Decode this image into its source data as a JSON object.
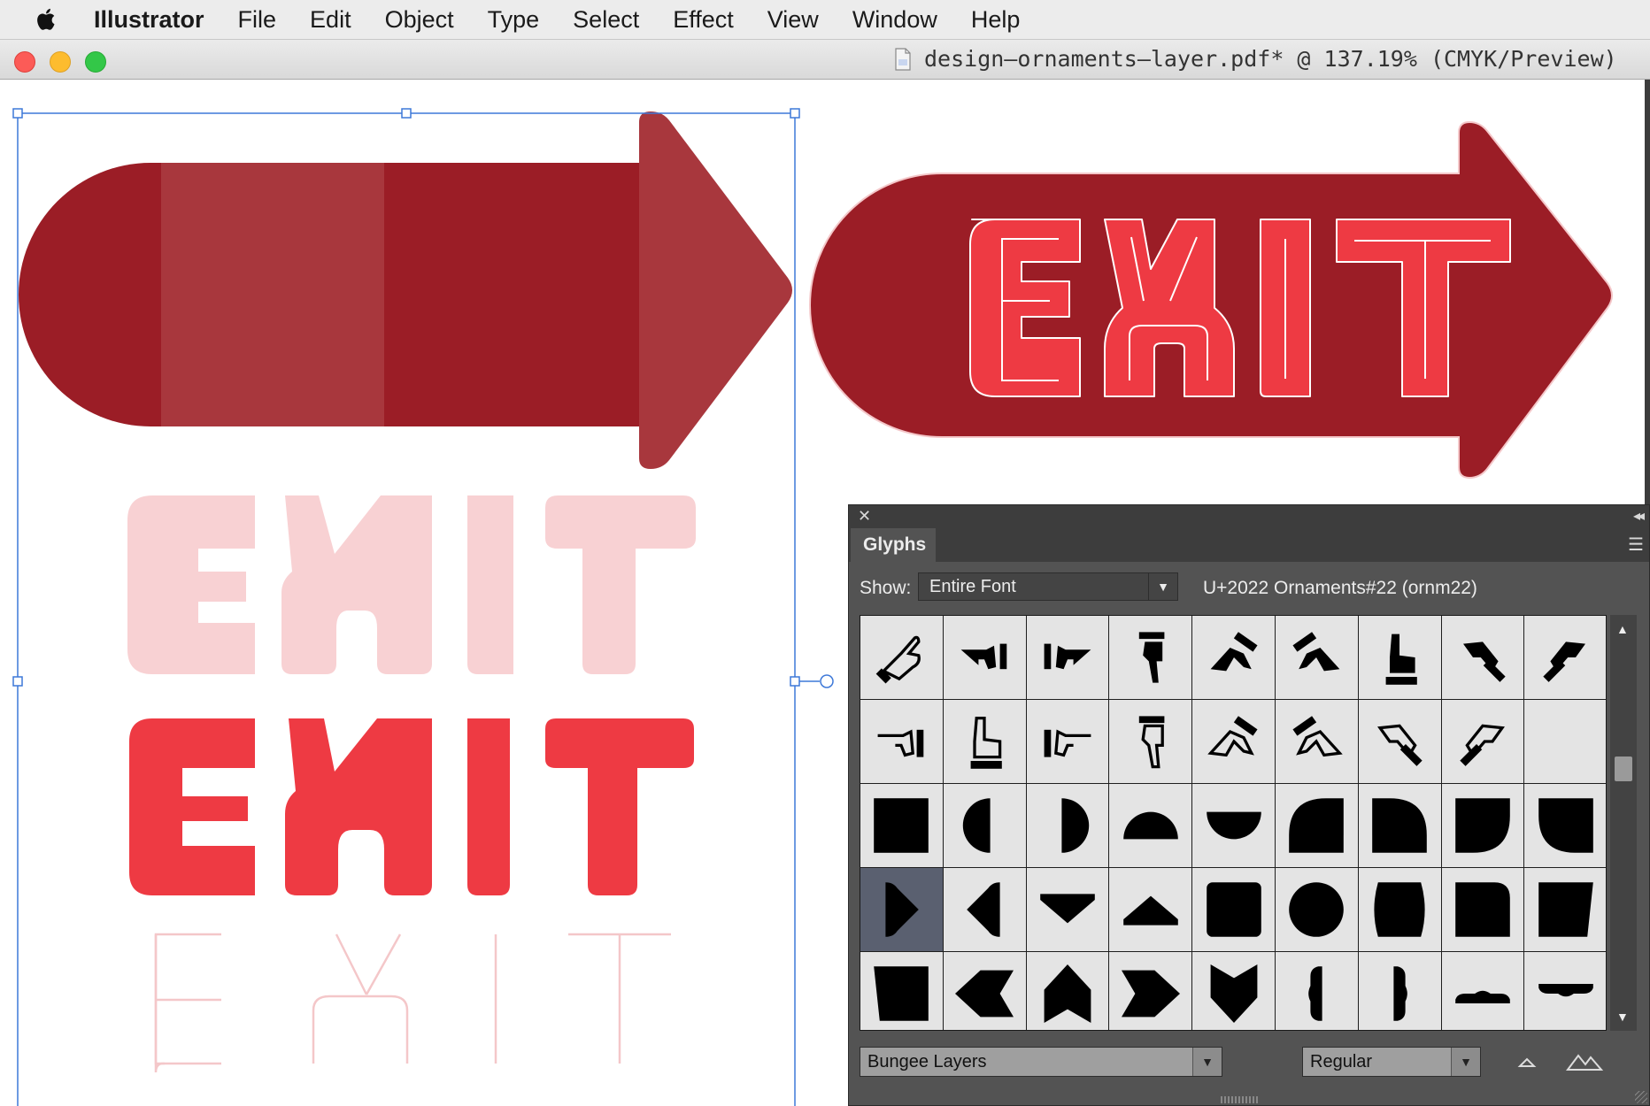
{
  "menubar": {
    "app_name": "Illustrator",
    "items": [
      "File",
      "Edit",
      "Object",
      "Type",
      "Select",
      "Effect",
      "View",
      "Window",
      "Help"
    ]
  },
  "document": {
    "title": "design–ornaments–layer.pdf* @ 137.19% (CMYK/Preview)"
  },
  "artwork": {
    "text": "EXIT",
    "colors": {
      "arrow_dark": "#9b1d26",
      "arrow_stripe": "#a8373d",
      "exit_red": "#ee3a43",
      "exit_pink": "#f8d1d3",
      "outline_pink": "#f4c7c9",
      "selection_blue": "#3d78d8"
    }
  },
  "glyphs_panel": {
    "tab_label": "Glyphs",
    "show_label": "Show:",
    "show_value": "Entire Font",
    "glyph_info": "U+2022 Ornaments#22 (ornm22)",
    "font_family": "Bungee Layers",
    "font_style": "Regular",
    "icons": [
      "close-icon",
      "collapse-icon",
      "panel-menu-icon",
      "dropdown-arrow-icon",
      "scroll-up-icon",
      "scroll-down-icon",
      "zoom-out-glyph-icon",
      "zoom-in-glyph-icon"
    ]
  }
}
